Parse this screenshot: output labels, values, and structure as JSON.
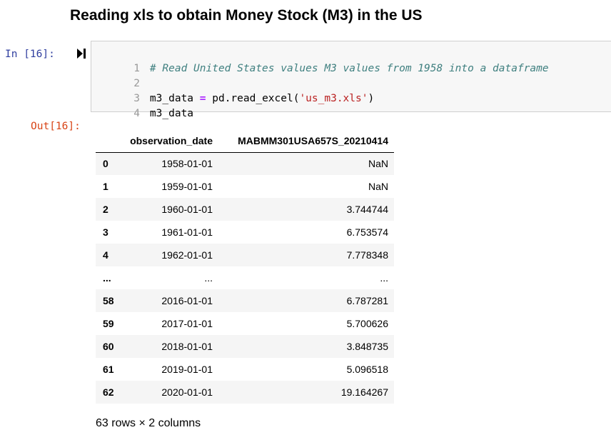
{
  "heading": "Reading xls to obtain Money Stock (M3) in the US",
  "input_cell": {
    "prompt": "In [16]:",
    "lines": [
      {
        "no": "1",
        "comment": "# Read United States values M3 values from 1958 into a dataframe"
      },
      {
        "no": "2"
      },
      {
        "no": "3",
        "var": "m3_data ",
        "op": "=",
        "call": " pd.read_excel(",
        "str": "'us_m3.xls'",
        "close": ")"
      },
      {
        "no": "4",
        "plain": "m3_data"
      }
    ]
  },
  "output_cell": {
    "prompt": "Out[16]:",
    "columns": [
      "",
      "observation_date",
      "MABMM301USA657S_20210414"
    ],
    "rows": [
      {
        "index": "0",
        "date": "1958-01-01",
        "value": "NaN"
      },
      {
        "index": "1",
        "date": "1959-01-01",
        "value": "NaN"
      },
      {
        "index": "2",
        "date": "1960-01-01",
        "value": "3.744744"
      },
      {
        "index": "3",
        "date": "1961-01-01",
        "value": "6.753574"
      },
      {
        "index": "4",
        "date": "1962-01-01",
        "value": "7.778348"
      },
      {
        "index": "...",
        "date": "...",
        "value": "..."
      },
      {
        "index": "58",
        "date": "2016-01-01",
        "value": "6.787281"
      },
      {
        "index": "59",
        "date": "2017-01-01",
        "value": "5.700626"
      },
      {
        "index": "60",
        "date": "2018-01-01",
        "value": "3.848735"
      },
      {
        "index": "61",
        "date": "2019-01-01",
        "value": "5.096518"
      },
      {
        "index": "62",
        "date": "2020-01-01",
        "value": "19.164267"
      }
    ],
    "shape": "63 rows × 2 columns"
  },
  "icons": {
    "run": "run-cell-icon"
  },
  "colors": {
    "in_prompt": "#303f9f",
    "out_prompt": "#d84315",
    "comment": "#408080",
    "operator": "#aa22ff",
    "string": "#ba2121"
  }
}
